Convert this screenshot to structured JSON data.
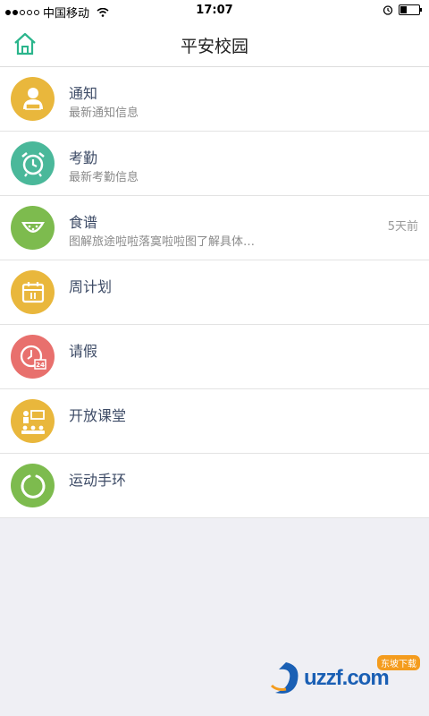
{
  "status": {
    "carrier": "中国移动",
    "time": "17:07"
  },
  "header": {
    "title": "平安校园"
  },
  "items": [
    {
      "title": "通知",
      "subtitle": "最新通知信息",
      "time": "",
      "icon": "teacher-icon",
      "color": "#e9b73c"
    },
    {
      "title": "考勤",
      "subtitle": "最新考勤信息",
      "time": "",
      "icon": "alarm-clock-icon",
      "color": "#4ab89a"
    },
    {
      "title": "食谱",
      "subtitle": "图解旅途啦啦落寞啦啦图了解具体…",
      "time": "5天前",
      "icon": "watermelon-icon",
      "color": "#7dbb4e"
    },
    {
      "title": "周计划",
      "subtitle": "",
      "time": "",
      "icon": "calendar-icon",
      "color": "#e9b73c"
    },
    {
      "title": "请假",
      "subtitle": "",
      "time": "",
      "icon": "clock-24-icon",
      "color": "#e8706d"
    },
    {
      "title": "开放课堂",
      "subtitle": "",
      "time": "",
      "icon": "classroom-icon",
      "color": "#e9b73c"
    },
    {
      "title": "运动手环",
      "subtitle": "",
      "time": "",
      "icon": "band-icon",
      "color": "#7dbb4e"
    }
  ],
  "watermark": {
    "text": "uzzf.com",
    "badge": "东坡下载"
  }
}
